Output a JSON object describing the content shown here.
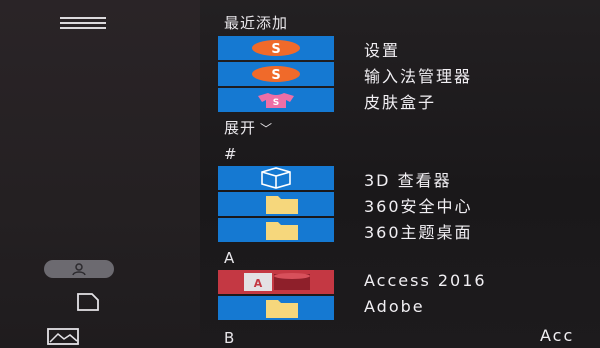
{
  "rail": {
    "icons": [
      "menu-icon",
      "user-icon",
      "document-icon",
      "pictures-icon"
    ]
  },
  "recent": {
    "title": "最近添加",
    "items": [
      {
        "label": "设置",
        "icon": "sogou-icon"
      },
      {
        "label": "输入法管理器",
        "icon": "sogou-icon"
      },
      {
        "label": "皮肤盒子",
        "icon": "skin-box-icon"
      }
    ]
  },
  "expand": {
    "label": "展开",
    "icon": "chevron-down-icon"
  },
  "groups": [
    {
      "letter": "#",
      "items": [
        {
          "label": "3D 查看器",
          "icon": "cube-icon"
        },
        {
          "label": "360安全中心",
          "icon": "folder-icon"
        },
        {
          "label": "360主题桌面",
          "icon": "folder-icon"
        }
      ]
    },
    {
      "letter": "A",
      "items": [
        {
          "label": "Access 2016",
          "icon": "access-icon"
        },
        {
          "label": "Adobe",
          "icon": "folder-icon"
        }
      ]
    },
    {
      "letter": "B",
      "items": []
    }
  ],
  "truncated_label": "Acc",
  "colors": {
    "tile_blue": "#1579d2",
    "tile_red": "#c43843",
    "background": "#1c1a1c"
  }
}
